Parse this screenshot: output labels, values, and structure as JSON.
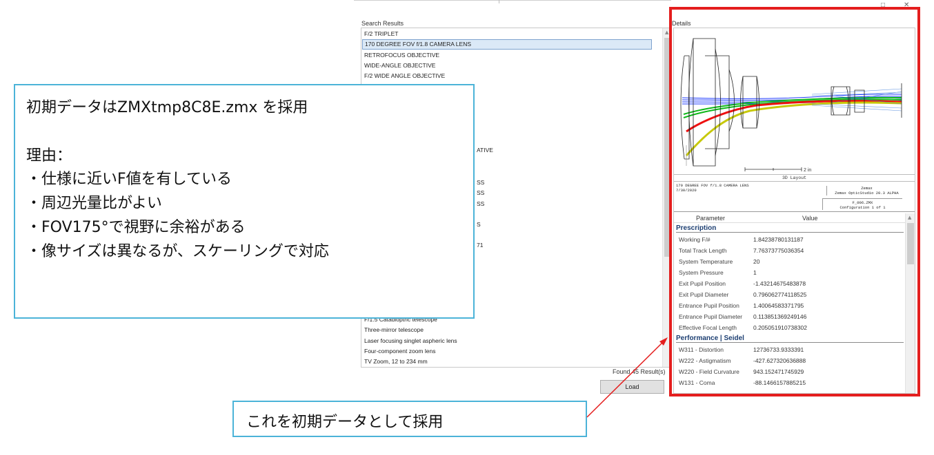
{
  "dialog": {
    "search_results_label": "Search Results",
    "details_label": "Details",
    "results": [
      {
        "label": "F/2 TRIPLET",
        "selected": false
      },
      {
        "label": "170 DEGREE FOV f/1.8  CAMERA LENS",
        "selected": true
      },
      {
        "label": "RETROFOCUS OBJECTIVE",
        "selected": false
      },
      {
        "label": "WIDE-ANGLE OBJECTIVE",
        "selected": false
      },
      {
        "label": "F/2 WIDE ANGLE OBJECTIVE",
        "selected": false
      }
    ],
    "partial_results": [
      "ATIVE",
      "SS",
      "SS",
      "SS",
      "S",
      "71"
    ],
    "bottom_results": [
      "F/1.5 Catadioptric telescope",
      "Three-mirror telescope",
      "Laser focusing singlet aspheric lens",
      "Four-component zoom lens",
      "TV Zoom, 12 to 234 mm"
    ],
    "found_text": "Found 45 Result(s)",
    "load_button": "Load",
    "layout": {
      "scale_label": "2 in",
      "caption": "3D Layout",
      "info_title": "170 DEGREE FOV f/1.8  CAMERA LENS",
      "info_date": "7/30/2020",
      "info_app_1": "Zemax",
      "info_app_2": "Zemax OpticStudio 20.3  ALPHA",
      "info_file": "F_006.ZMX",
      "info_config": "Configuration 1 of 1"
    },
    "table": {
      "col_parameter": "Parameter",
      "col_value": "Value",
      "section1": "Prescription",
      "rows1": [
        {
          "name": "Working F/#",
          "value": "1.84238780131187"
        },
        {
          "name": "Total Track Length",
          "value": "7.76373775036354"
        },
        {
          "name": "System Temperature",
          "value": "20"
        },
        {
          "name": "System Pressure",
          "value": "1"
        },
        {
          "name": "Exit Pupil Position",
          "value": "-1.43214675483878"
        },
        {
          "name": "Exit Pupil Diameter",
          "value": "0.796062774118525"
        },
        {
          "name": "Entrance Pupil Position",
          "value": "1.40064583371795"
        },
        {
          "name": "Entrance Pupil Diameter",
          "value": "0.113851369249146"
        },
        {
          "name": "Effective Focal Length",
          "value": "0.205051910738302"
        }
      ],
      "section2": "Performance | Seidel",
      "rows2": [
        {
          "name": "W311 - Distortion",
          "value": "12736733.9333391"
        },
        {
          "name": "W222 - Astigmatism",
          "value": "-427.627320636888"
        },
        {
          "name": "W220 - Field Curvature",
          "value": "943.152471745929"
        },
        {
          "name": "W131 - Coma",
          "value": "-88.1466157885215"
        }
      ]
    }
  },
  "note": {
    "line1": "初期データはZMXtmp8C8E.zmx を採用",
    "line2": "理由：",
    "line3": "・仕様に近いF値を有している",
    "line4": "・周辺光量比がよい",
    "line5": "・FOV175°で視野に余裕がある",
    "line6": "・像サイズは異なるが、スケーリングで対応"
  },
  "callout": {
    "text": "これを初期データとして採用"
  },
  "colors": {
    "highlight_red": "#e41e1e",
    "note_border": "#4bb3d8",
    "selected_row": "#dbe9f7",
    "section_text": "#1d3f72"
  }
}
